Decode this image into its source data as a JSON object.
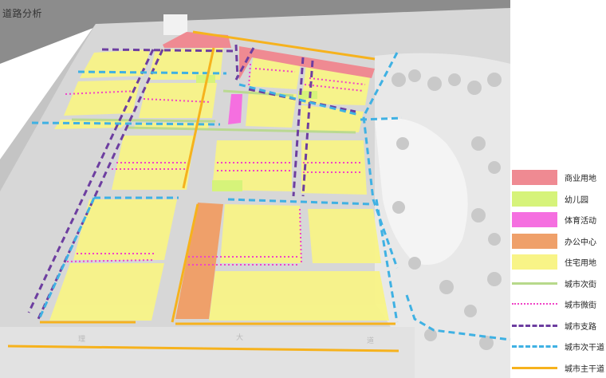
{
  "title": "道路分析",
  "colors": {
    "commercial": "#ef8a92",
    "kindergarten": "#d6f37a",
    "sports": "#f56fe0",
    "office": "#efa06a",
    "residential": "#f8f487",
    "city_secondary_street": "#b7d98b",
    "city_micro_street": "#f043c7",
    "city_branch_road": "#6d3ea0",
    "city_secondary_arterial": "#3fb1e3",
    "city_main_arterial": "#f6b21d"
  },
  "legend": [
    {
      "key": "commercial",
      "label": "商业用地",
      "kind": "fill"
    },
    {
      "key": "kindergarten",
      "label": "幼儿园",
      "kind": "fill"
    },
    {
      "key": "sports",
      "label": "体育活动",
      "kind": "fill"
    },
    {
      "key": "office",
      "label": "办公中心",
      "kind": "fill"
    },
    {
      "key": "residential",
      "label": "住宅用地",
      "kind": "fill"
    },
    {
      "key": "city_secondary_street",
      "label": "城市次街",
      "kind": "solid"
    },
    {
      "key": "city_micro_street",
      "label": "城市微街",
      "kind": "dotted"
    },
    {
      "key": "city_branch_road",
      "label": "城市支路",
      "kind": "dashed"
    },
    {
      "key": "city_secondary_arterial",
      "label": "城市次干道",
      "kind": "dashed"
    },
    {
      "key": "city_main_arterial",
      "label": "城市主干道",
      "kind": "solid"
    }
  ]
}
